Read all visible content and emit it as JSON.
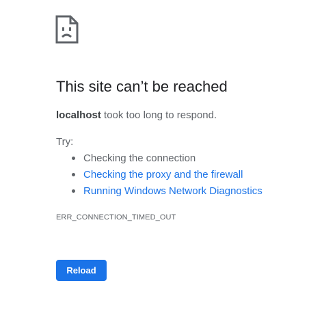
{
  "icon": {
    "name": "sad-document-icon"
  },
  "headline": "This site can’t be reached",
  "summary": {
    "host": "localhost",
    "message": " took too long to respond."
  },
  "try_label": "Try:",
  "suggestions": [
    {
      "label": "Checking the connection",
      "is_link": false
    },
    {
      "label": "Checking the proxy and the firewall",
      "is_link": true
    },
    {
      "label": "Running Windows Network Diagnostics",
      "is_link": true
    }
  ],
  "error_code": "ERR_CONNECTION_TIMED_OUT",
  "reload_label": "Reload",
  "colors": {
    "link": "#1a73e8",
    "button_bg": "#1a73e8",
    "text_secondary": "#5f6368",
    "text_primary": "#202124"
  }
}
